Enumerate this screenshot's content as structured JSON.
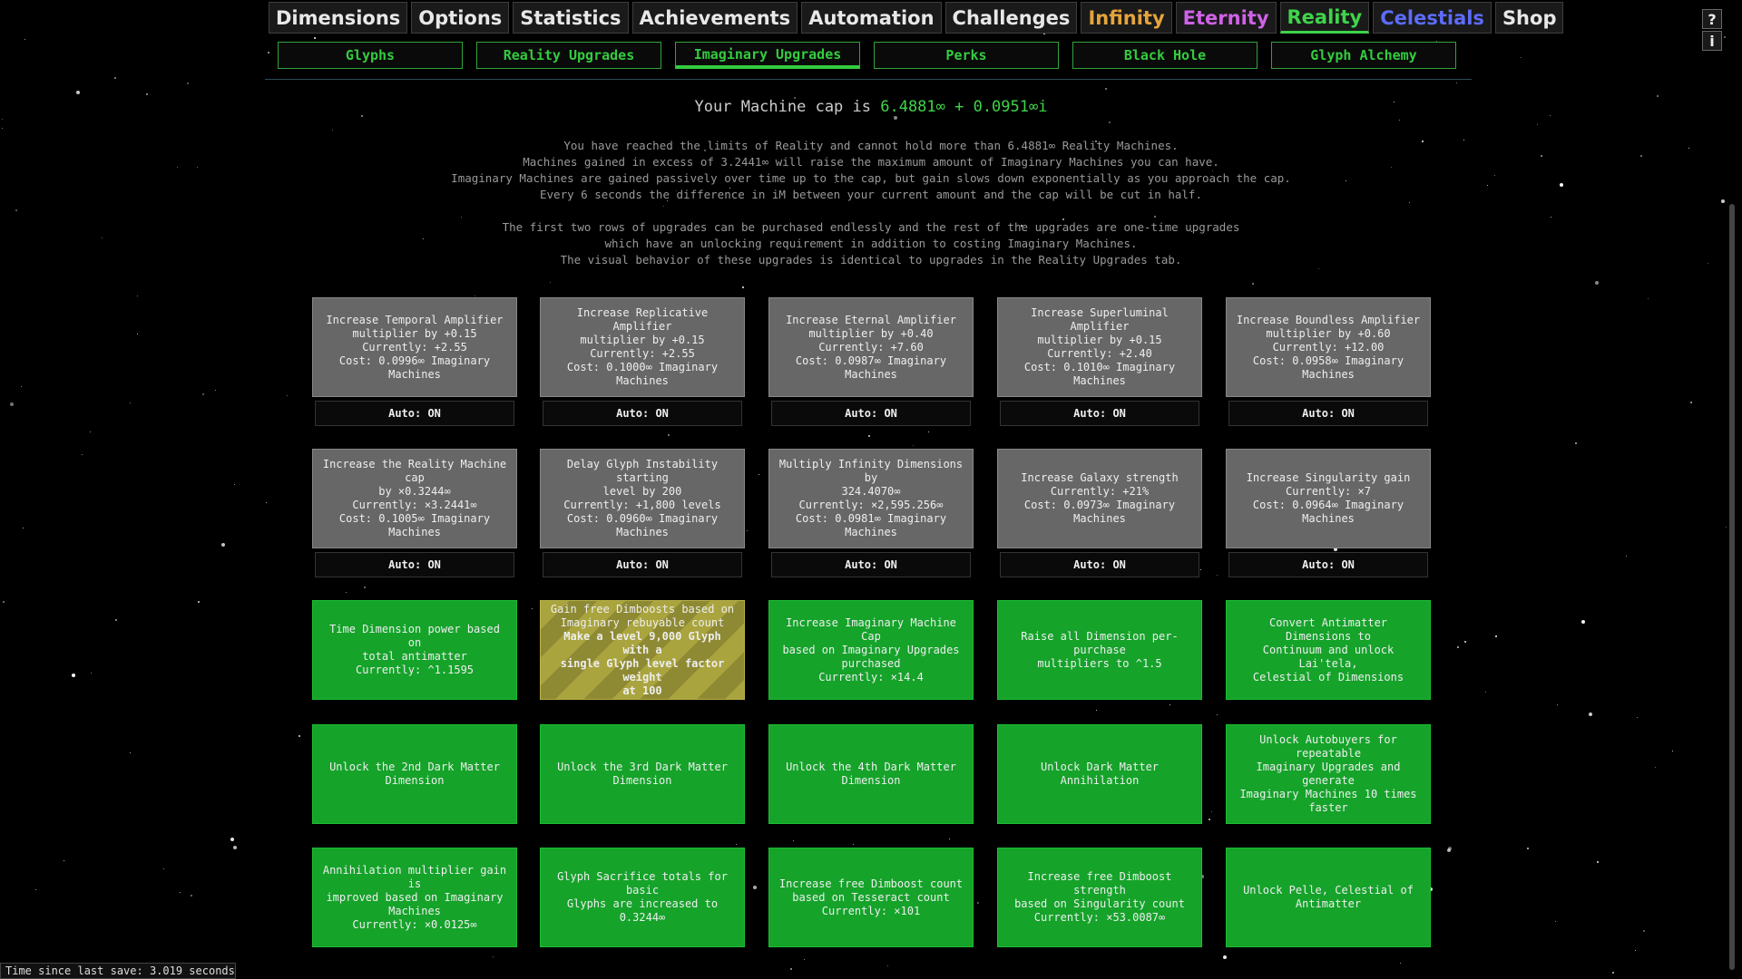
{
  "nav": {
    "tabs": [
      "Dimensions",
      "Options",
      "Statistics",
      "Achievements",
      "Automation",
      "Challenges",
      "Infinity",
      "Eternity",
      "Reality",
      "Celestials",
      "Shop"
    ],
    "help": "?",
    "info": "i"
  },
  "subnav": {
    "tabs": [
      "Glyphs",
      "Reality Upgrades",
      "Imaginary Upgrades",
      "Perks",
      "Black Hole",
      "Glyph Alchemy"
    ]
  },
  "header": {
    "cap_prefix": "Your Machine cap is ",
    "cap_value": "6.4881∞ + 0.0951∞i",
    "info_lines": [
      "You have reached the limits of Reality and cannot hold more than 6.4881∞ Reality Machines.",
      "Machines gained in excess of 3.2441∞ will raise the maximum amount of Imaginary Machines you can have.",
      "Imaginary Machines are gained passively over time up to the cap, but gain slows down exponentially as you approach the cap.",
      "Every 6 seconds the difference in iM between your current amount and the cap will be cut in half."
    ],
    "info_lines2": [
      "The first two rows of upgrades can be purchased endlessly and the rest of the upgrades are one-time upgrades",
      "which have an unlocking requirement in addition to costing Imaginary Machines.",
      "The visual behavior of these upgrades is identical to upgrades in the Reality Upgrades tab."
    ]
  },
  "rebuyables": [
    {
      "lines": [
        "Increase Temporal Amplifier",
        "multiplier by +0.15",
        "Currently: +2.55",
        "Cost: 0.0996∞ Imaginary Machines"
      ],
      "auto": "Auto: ON"
    },
    {
      "lines": [
        "Increase Replicative Amplifier",
        "multiplier by +0.15",
        "Currently: +2.55",
        "Cost: 0.1000∞ Imaginary Machines"
      ],
      "auto": "Auto: ON"
    },
    {
      "lines": [
        "Increase Eternal Amplifier",
        "multiplier by +0.40",
        "Currently: +7.60",
        "Cost: 0.0987∞ Imaginary Machines"
      ],
      "auto": "Auto: ON"
    },
    {
      "lines": [
        "Increase Superluminal Amplifier",
        "multiplier by +0.15",
        "Currently: +2.40",
        "Cost: 0.1010∞ Imaginary Machines"
      ],
      "auto": "Auto: ON"
    },
    {
      "lines": [
        "Increase Boundless Amplifier",
        "multiplier by +0.60",
        "Currently: +12.00",
        "Cost: 0.0958∞ Imaginary Machines"
      ],
      "auto": "Auto: ON"
    },
    {
      "lines": [
        "Increase the Reality Machine cap",
        "by ×0.3244∞",
        "Currently: ×3.2441∞",
        "Cost: 0.1005∞ Imaginary Machines"
      ],
      "auto": "Auto: ON"
    },
    {
      "lines": [
        "Delay Glyph Instability starting",
        "level by 200",
        "Currently: +1,800 levels",
        "Cost: 0.0960∞ Imaginary Machines"
      ],
      "auto": "Auto: ON"
    },
    {
      "lines": [
        "Multiply Infinity Dimensions by",
        "324.4070∞",
        "Currently: ×2,595.256∞",
        "Cost: 0.0981∞ Imaginary Machines"
      ],
      "auto": "Auto: ON"
    },
    {
      "lines": [
        "Increase Galaxy strength",
        "Currently: +21%",
        "Cost: 0.0973∞ Imaginary Machines"
      ],
      "auto": "Auto: ON"
    },
    {
      "lines": [
        "Increase Singularity gain",
        "Currently: ×7",
        "Cost: 0.0964∞ Imaginary Machines"
      ],
      "auto": "Auto: ON"
    }
  ],
  "onetime": [
    {
      "lines": [
        "Time Dimension power based on",
        "total antimatter",
        "Currently: ^1.1595"
      ]
    },
    {
      "lines": [
        "Gain free Dimboosts based on",
        "Imaginary rebuyable count"
      ],
      "req": [
        "Make a level 9,000 Glyph with a",
        "single Glyph level factor weight",
        "at 100"
      ]
    },
    {
      "lines": [
        "Increase Imaginary Machine Cap",
        "based on Imaginary Upgrades",
        "purchased",
        "Currently: ×14.4"
      ]
    },
    {
      "lines": [
        "Raise all Dimension per-purchase",
        "multipliers to ^1.5"
      ]
    },
    {
      "lines": [
        "Convert Antimatter Dimensions to",
        "Continuum and unlock Lai'tela,",
        "Celestial of Dimensions"
      ]
    },
    {
      "lines": [
        "Unlock the 2nd Dark Matter",
        "Dimension"
      ]
    },
    {
      "lines": [
        "Unlock the 3rd Dark Matter",
        "Dimension"
      ]
    },
    {
      "lines": [
        "Unlock the 4th Dark Matter",
        "Dimension"
      ]
    },
    {
      "lines": [
        "Unlock Dark Matter Annihilation"
      ]
    },
    {
      "lines": [
        "Unlock Autobuyers for repeatable",
        "Imaginary Upgrades and generate",
        "Imaginary Machines 10 times",
        "faster"
      ]
    },
    {
      "lines": [
        "Annihilation multiplier gain is",
        "improved based on Imaginary",
        "Machines",
        "Currently: ×0.0125∞"
      ]
    },
    {
      "lines": [
        "Glyph Sacrifice totals for basic",
        "Glyphs are increased to 0.3244∞"
      ]
    },
    {
      "lines": [
        "Increase free Dimboost count",
        "based on Tesseract count",
        "Currently: ×101"
      ]
    },
    {
      "lines": [
        "Increase free Dimboost strength",
        "based on Singularity count",
        "Currently: ×53.0087∞"
      ]
    },
    {
      "lines": [
        "Unlock Pelle, Celestial of",
        "Antimatter"
      ]
    }
  ],
  "save_status": "Time since last save: 3.019 seconds"
}
